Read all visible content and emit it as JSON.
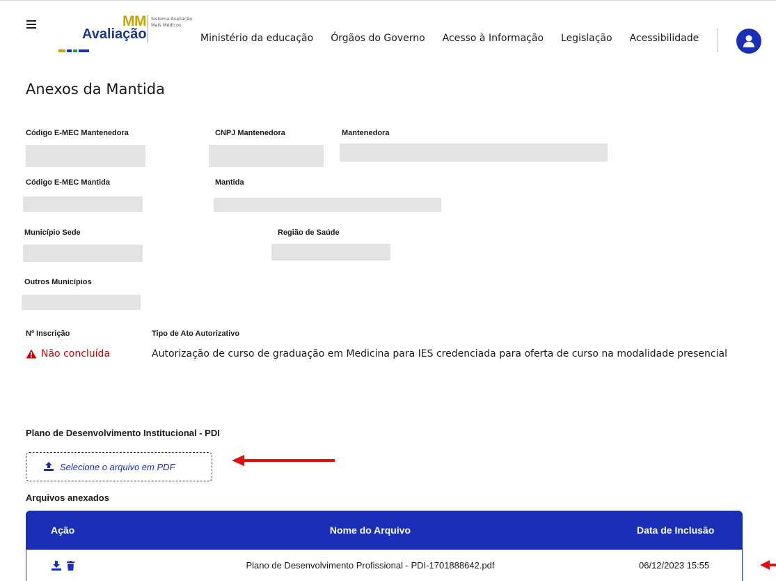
{
  "header": {
    "menu_icon": "hamburger-icon",
    "logo": {
      "brand": "MM",
      "name": "Avaliação",
      "subtitle": "Sistema Avaliação Mais Médicos",
      "bar_colors": [
        "#c9a400",
        "#1a2fb8",
        "#1a9b3c",
        "#1a2fb8"
      ]
    },
    "nav": [
      "Ministério da educação",
      "Órgãos do Governo",
      "Acesso à Informação",
      "Legislação",
      "Acessibilidade"
    ],
    "avatar_icon": "user-icon",
    "accent": "#1a2fb8"
  },
  "page": {
    "title": "Anexos da Mantida"
  },
  "fields": {
    "codigo_mantenedora": {
      "label": "Código E-MEC Mantenedora",
      "value": ""
    },
    "cnpj_mantenedora": {
      "label": "CNPJ Mantenedora",
      "value": ""
    },
    "mantenedora": {
      "label": "Mantenedora",
      "value": ""
    },
    "codigo_mantida": {
      "label": "Código E-MEC Mantida",
      "value": ""
    },
    "mantida": {
      "label": "Mantida",
      "value": ""
    },
    "municipio_sede": {
      "label": "Município Sede",
      "value": ""
    },
    "regiao_saude": {
      "label": "Região de Saúde",
      "value": ""
    },
    "outros_municipios": {
      "label": "Outros Municípios",
      "value": ""
    },
    "inscricao": {
      "label": "Nº Inscrição",
      "status": "Não concluída",
      "status_icon": "warning-icon",
      "status_color": "#d40000"
    },
    "tipo_ato": {
      "label": "Tipo de Ato Autorizativo",
      "value": "Autorização de curso de graduação em Medicina para IES credenciada para oferta de curso na modalidade presencial"
    }
  },
  "pdi": {
    "section_title": "Plano de Desenvolvimento Institucional - PDI",
    "upload_label": "Selecione o arquivo em PDF",
    "upload_icon": "upload-icon"
  },
  "files": {
    "title": "Arquivos anexados",
    "columns": [
      "Ação",
      "Nome do Arquivo",
      "Data de Inclusão"
    ],
    "rows": [
      {
        "actions": [
          "download-icon",
          "trash-icon"
        ],
        "name": "Plano de Desenvolvimento Profissional - PDI-1701888642.pdf",
        "date": "06/12/2023 15:55"
      }
    ]
  },
  "annotation_color": "#e01010"
}
